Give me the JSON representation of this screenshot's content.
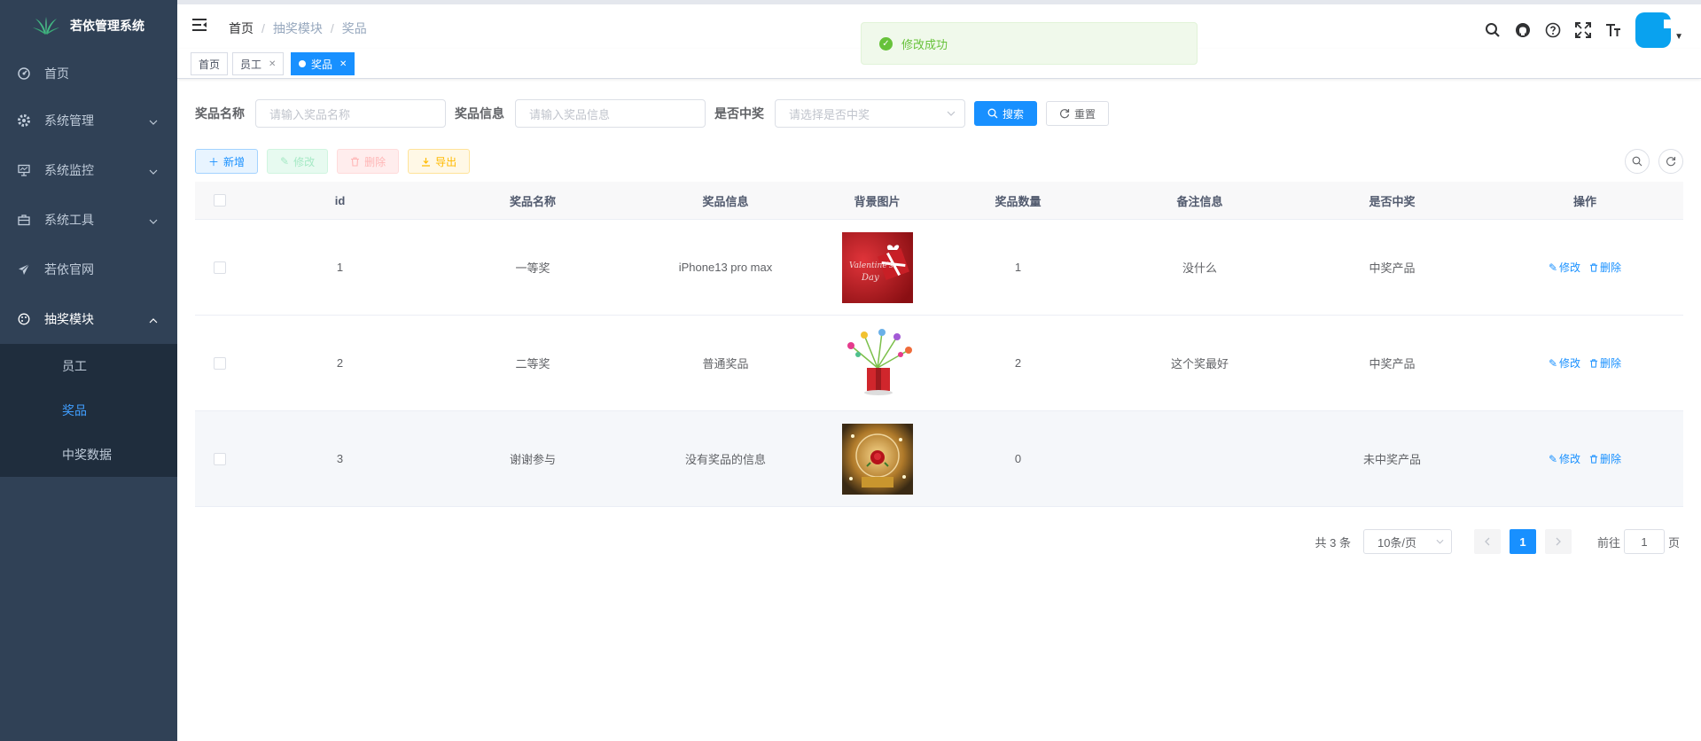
{
  "sidebar": {
    "title": "若依管理系统",
    "items": [
      {
        "label": "首页",
        "icon": "dashboard-icon"
      },
      {
        "label": "系统管理",
        "icon": "gear-icon"
      },
      {
        "label": "系统监控",
        "icon": "monitor-icon"
      },
      {
        "label": "系统工具",
        "icon": "toolbox-icon"
      },
      {
        "label": "若依官网",
        "icon": "paper-plane-icon"
      },
      {
        "label": "抽奖模块",
        "icon": "palette-icon"
      }
    ],
    "sub_items": [
      {
        "label": "员工"
      },
      {
        "label": "奖品",
        "active": true
      },
      {
        "label": "中奖数据"
      }
    ]
  },
  "navbar": {
    "breadcrumb": [
      "首页",
      "抽奖模块",
      "奖品"
    ],
    "breadcrumb_sep": "/"
  },
  "tags": [
    "首页",
    "员工",
    "奖品"
  ],
  "toast": {
    "message": "修改成功",
    "color": "#67c23a"
  },
  "search": {
    "name_label": "奖品名称",
    "name_placeholder": "请输入奖品名称",
    "info_label": "奖品信息",
    "info_placeholder": "请输入奖品信息",
    "win_label": "是否中奖",
    "win_placeholder": "请选择是否中奖",
    "search_btn": "搜索",
    "reset_btn": "重置"
  },
  "toolbar": {
    "add": "新增",
    "edit": "修改",
    "delete": "删除",
    "export": "导出"
  },
  "table": {
    "headers": [
      "id",
      "奖品名称",
      "奖品信息",
      "背景图片",
      "奖品数量",
      "备注信息",
      "是否中奖",
      "操作"
    ],
    "rows": [
      {
        "id": "1",
        "name": "一等奖",
        "info": "iPhone13 pro max",
        "image": "red-gift-box",
        "count": "1",
        "remark": "没什么",
        "win": "中奖产品"
      },
      {
        "id": "2",
        "name": "二等奖",
        "info": "普通奖品",
        "image": "gift-with-flowers",
        "count": "2",
        "remark": "这个奖最好",
        "win": "中奖产品"
      },
      {
        "id": "3",
        "name": "谢谢参与",
        "info": "没有奖品的信息",
        "image": "snow-globe-rose",
        "count": "0",
        "remark": "",
        "win": "未中奖产品"
      }
    ],
    "op_edit": "修改",
    "op_delete": "删除"
  },
  "pagination": {
    "total": "共 3 条",
    "page_size": "10条/页",
    "current_page": "1",
    "goto_label": "前往",
    "goto_value": "1",
    "page_unit": "页"
  },
  "colors": {
    "sidebar_bg": "#304156",
    "primary": "#1890ff",
    "success": "#67c23a"
  }
}
